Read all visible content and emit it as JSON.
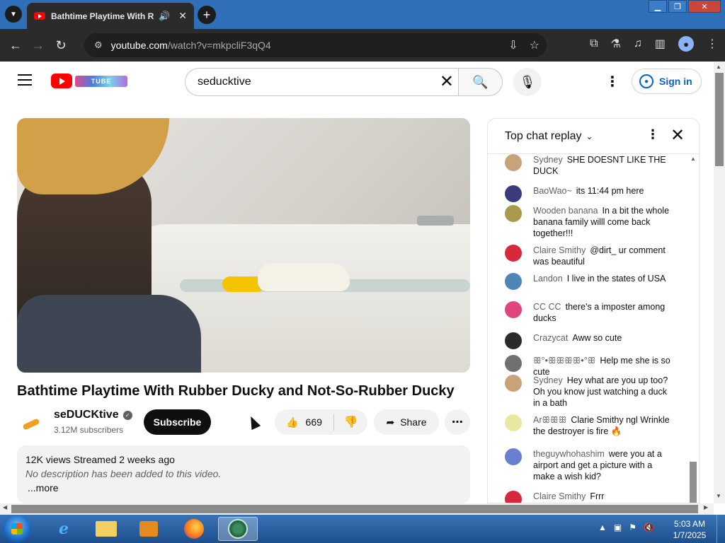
{
  "browser": {
    "tab_title": "Bathtime Playtime With Rubber Ducky and Not-So-Rubber Ducky",
    "url_host": "youtube.com",
    "url_path": "/watch?v=mkpcliF3qQ4"
  },
  "header": {
    "search_value": "seducktive",
    "sign_in_label": "Sign in",
    "logo_text": "TUBE"
  },
  "video": {
    "title": "Bathtime Playtime With Rubber Ducky and Not-So-Rubber Ducky",
    "channel_name": "seDUCKtive",
    "subscribers": "3.12M subscribers",
    "subscribe_label": "Subscribe",
    "likes": "669",
    "share_label": "Share",
    "views_meta": "12K views  Streamed 2 weeks ago",
    "description": "No description has been added to this video.",
    "more_label": "...more"
  },
  "chat": {
    "title": "Top chat replay",
    "messages": [
      {
        "author": "Sydney",
        "text": "SHE DOESNT LIKE THE DUCK",
        "avatar_color": "#c9a27a"
      },
      {
        "author": "BaoWao~",
        "text": "its 11:44 pm here",
        "avatar_color": "#3b3b7a"
      },
      {
        "author": "Wooden banana",
        "text": "In a bit the whole banana family willl come back together!!!",
        "avatar_color": "#a89a4a"
      },
      {
        "author": "Claire Smithy",
        "text": "@dirt_ ur comment was beautiful",
        "avatar_color": "#d8283c"
      },
      {
        "author": "Landon",
        "text": "I live in the states of USA",
        "avatar_color": "#4f86b8"
      },
      {
        "author": "CC CC",
        "text": "there's a imposter among ducks",
        "avatar_color": "#e0457b"
      },
      {
        "author": "Crazycat",
        "text": "Aww so cute",
        "avatar_color": "#2b2b2b"
      },
      {
        "author": "ꕥ°•ꕥꕥꕥꕥ•°ꕥ",
        "text": "Help me she is so cute",
        "avatar_color": "#707070"
      },
      {
        "author": "Sydney",
        "text": "Hey what are you up too? Oh you know just watching a duck in a bath",
        "avatar_color": "#c9a27a"
      },
      {
        "author": "Arꕥꕥꕥ",
        "text": "Clarie Smithy ngl Wrinkle the destroyer is fire 🔥",
        "avatar_color": "#e8e8a0"
      },
      {
        "author": "theguywhohashim",
        "text": "were you at a airport and get a picture with a make a wish kid?",
        "avatar_color": "#6a7fd0"
      },
      {
        "author": "Claire Smithy",
        "text": "Frrr",
        "avatar_color": "#d8283c"
      }
    ]
  },
  "taskbar": {
    "time": "5:03 AM",
    "date": "1/7/2025"
  }
}
